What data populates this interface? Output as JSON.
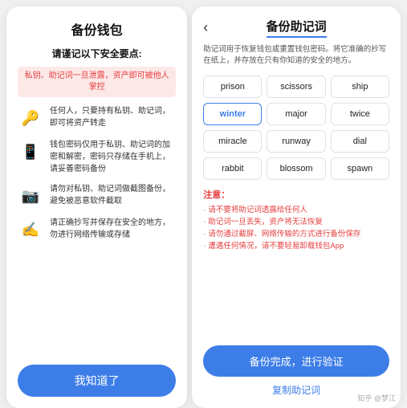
{
  "left": {
    "title": "备份钱包",
    "subtitle": "请谨记以下安全要点:",
    "warning": "私钥、助记词一旦泄露，资产即可被他人掌控",
    "items": [
      {
        "icon": "🔑",
        "text": "任何人，只要持有私钥、助记词，即可将资产转走"
      },
      {
        "icon": "📱",
        "text": "钱包密码仅用于私钥、助记词的加密和解密，密码只存储在手机上，请妥善密码备份"
      },
      {
        "icon": "📷",
        "text": "请勿对私钥、助记词做截图备份，避免被恶意软件截取"
      },
      {
        "icon": "✍️",
        "text": "请正确抄写并保存在安全的地方，勿进行网络传输或存储"
      }
    ],
    "btn_label": "我知道了"
  },
  "right": {
    "title": "备份助记词",
    "back_icon": "‹",
    "desc": "助记词用于恢复钱包或重置钱包密码。将它准确的抄写在纸上，并存放在只有你知道的安全的地方。",
    "words": [
      {
        "word": "prison",
        "highlight": false
      },
      {
        "word": "scissors",
        "highlight": false
      },
      {
        "word": "ship",
        "highlight": false
      },
      {
        "word": "winter",
        "highlight": true
      },
      {
        "word": "major",
        "highlight": false
      },
      {
        "word": "twice",
        "highlight": false
      },
      {
        "word": "miracle",
        "highlight": false
      },
      {
        "word": "runway",
        "highlight": false
      },
      {
        "word": "dial",
        "highlight": false
      },
      {
        "word": "rabbit",
        "highlight": false
      },
      {
        "word": "blossom",
        "highlight": false
      },
      {
        "word": "spawn",
        "highlight": false
      }
    ],
    "notes_title": "注意：",
    "notes": [
      "请不要将助记词透露给任何人",
      "助记词一旦丢失，资产将无法恢复",
      "请勿通过截屏、网络传输的方式进行备份保存",
      "遭遇任何情况，请不要轻易卸载钱包App"
    ],
    "confirm_btn": "备份完成，进行验证",
    "copy_btn": "复制助记词"
  },
  "watermark": "知乎 @梦江"
}
